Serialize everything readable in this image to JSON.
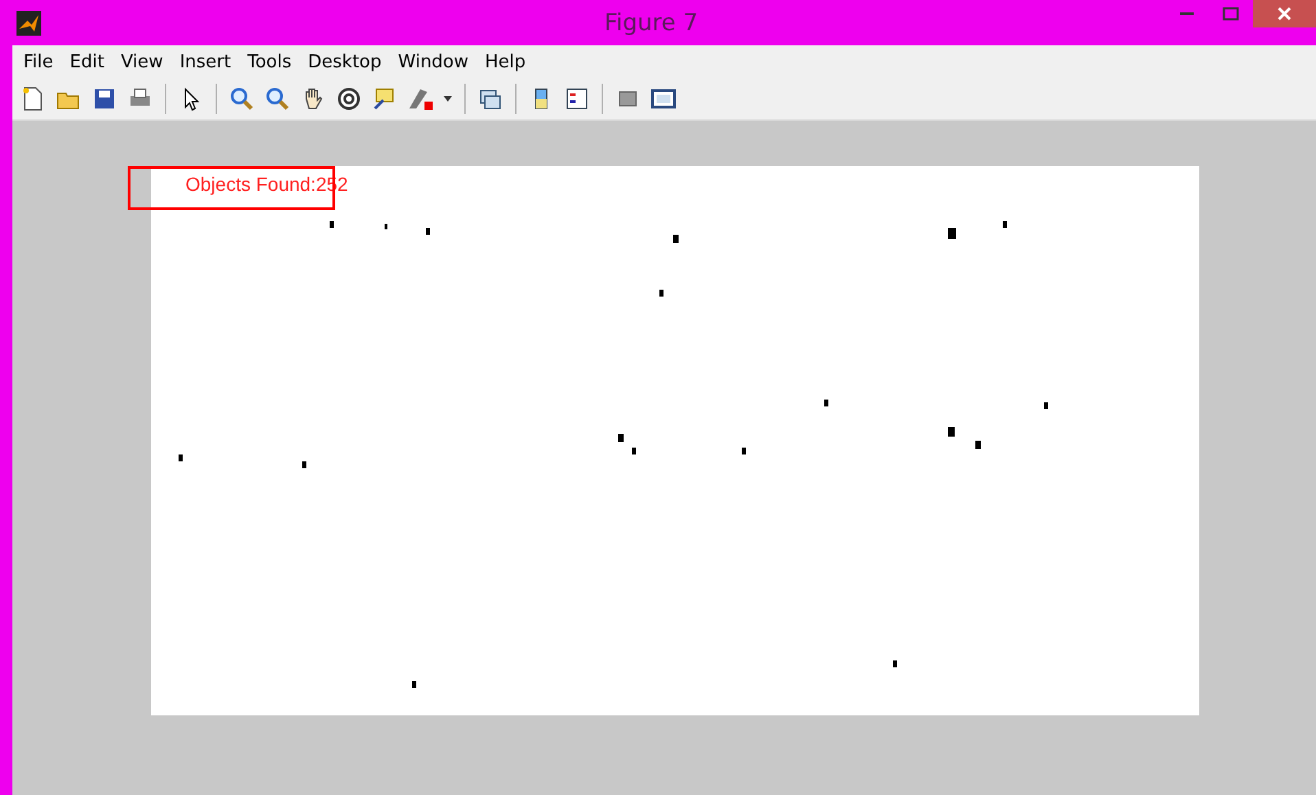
{
  "window": {
    "title": "Figure 7"
  },
  "menu": [
    "File",
    "Edit",
    "View",
    "Insert",
    "Tools",
    "Desktop",
    "Window",
    "Help"
  ],
  "annotation": {
    "text": "Objects Found:252"
  }
}
